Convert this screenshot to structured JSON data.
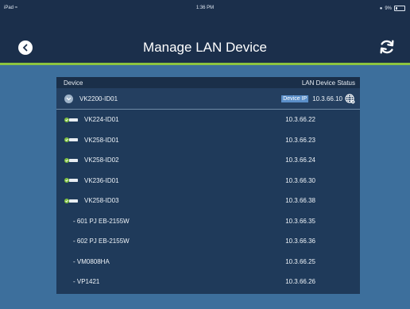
{
  "statusbar": {
    "device": "iPad",
    "time": "1:36 PM",
    "battery": "9%"
  },
  "header": {
    "title": "Manage LAN Device"
  },
  "table": {
    "col_device": "Device",
    "col_status": "LAN Device Status",
    "main_device": {
      "name": "VK2200-ID01",
      "tag": "Device IP",
      "ip": "10.3.66.10"
    },
    "devices": [
      {
        "name": "VK224-ID01",
        "ip": "10.3.66.22"
      },
      {
        "name": "VK258-ID01",
        "ip": "10.3.66.23"
      },
      {
        "name": "VK258-ID02",
        "ip": "10.3.66.24"
      },
      {
        "name": "VK236-ID01",
        "ip": "10.3.66.30"
      },
      {
        "name": "VK258-ID03",
        "ip": "10.3.66.38"
      }
    ],
    "sub_devices": [
      {
        "name": "- 601 PJ  EB-2155W",
        "ip": "10.3.66.35"
      },
      {
        "name": "- 602 PJ  EB-2155W",
        "ip": "10.3.66.36"
      },
      {
        "name": "- VM0808HA",
        "ip": "10.3.66.25"
      },
      {
        "name": "- VP1421",
        "ip": "10.3.66.26"
      }
    ]
  },
  "colors": {
    "accent_green": "#8cc43f",
    "nav_bg": "#1b2f4b",
    "page_bg": "#3d6f9c",
    "tag_bg": "#5b8fc9"
  }
}
